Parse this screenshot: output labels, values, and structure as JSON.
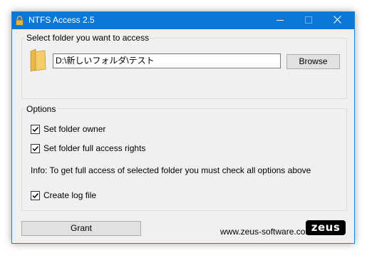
{
  "window": {
    "title": "NTFS Access 2.5",
    "accent_color": "#0b78d7"
  },
  "titlebar_buttons": {
    "minimize_icon": "minimize-icon",
    "maximize_icon": "maximize-icon",
    "close_icon": "close-icon"
  },
  "folder_group": {
    "label": "Select folder you want to access",
    "path_value": "D:\\新しいフォルダ\\テスト",
    "browse_label": "Browse",
    "icon": "folder-icon"
  },
  "options_group": {
    "label": "Options",
    "set_owner_label": "Set folder owner",
    "set_owner_checked": true,
    "full_access_label": "Set folder full access rights",
    "full_access_checked": true,
    "info_text": "Info: To get full access of selected folder you must check all options above",
    "log_label": "Create log file",
    "log_checked": true
  },
  "footer": {
    "grant_label": "Grant",
    "website": "www.zeus-software.com",
    "logo_text": "zeus"
  }
}
